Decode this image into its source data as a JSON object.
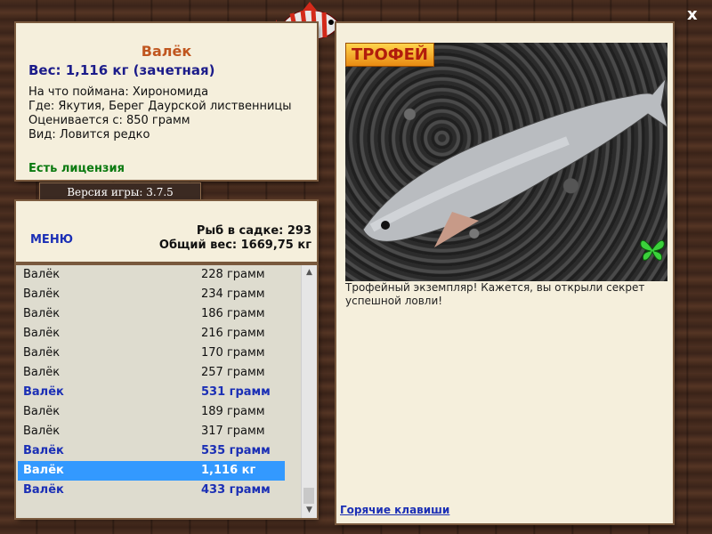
{
  "info": {
    "fish_name": "Валёк",
    "weight_line": "Вес: 1,116 кг (зачетная)",
    "caught_on": "На что поймана: Хирономида",
    "location": "Где: Якутия, Берег Даурской лиственницы",
    "min_weight": "Оценивается с: 850 грамм",
    "rarity": "Вид: Ловится редко",
    "license": "Есть лицензия"
  },
  "version": "Версия игры: 3.7.5",
  "menu": {
    "label": "МЕНЮ",
    "fish_count": "Рыб в садке: 293",
    "total_weight": "Общий вес: 1669,75 кг"
  },
  "list": [
    {
      "name": "Валёк",
      "weight": "228 грамм",
      "style": "normal"
    },
    {
      "name": "Валёк",
      "weight": "234 грамм",
      "style": "normal"
    },
    {
      "name": "Валёк",
      "weight": "186 грамм",
      "style": "normal"
    },
    {
      "name": "Валёк",
      "weight": "216 грамм",
      "style": "normal"
    },
    {
      "name": "Валёк",
      "weight": "170 грамм",
      "style": "normal"
    },
    {
      "name": "Валёк",
      "weight": "257 грамм",
      "style": "normal"
    },
    {
      "name": "Валёк",
      "weight": "531 грамм",
      "style": "bold"
    },
    {
      "name": "Валёк",
      "weight": "189 грамм",
      "style": "normal"
    },
    {
      "name": "Валёк",
      "weight": "317 грамм",
      "style": "normal"
    },
    {
      "name": "Валёк",
      "weight": "535 грамм",
      "style": "bold"
    },
    {
      "name": "Валёк",
      "weight": "1,116 кг",
      "style": "selected"
    },
    {
      "name": "Валёк",
      "weight": "433 грамм",
      "style": "bold"
    }
  ],
  "trophy_label": "ТРОФЕЙ",
  "description": "Трофейный экземпляр! Кажется, вы открыли секрет успешной ловли!",
  "hotkeys": "Горячие клавиши",
  "close_label": "x",
  "colors": {
    "accent": "#1b2fb5",
    "title": "#c0561f",
    "license": "#0b7a10",
    "selected": "#3399ff"
  },
  "icons": [
    "fish-logo-icon",
    "butterfly-icon",
    "close-icon",
    "scroll-up-icon",
    "scroll-down-icon"
  ]
}
